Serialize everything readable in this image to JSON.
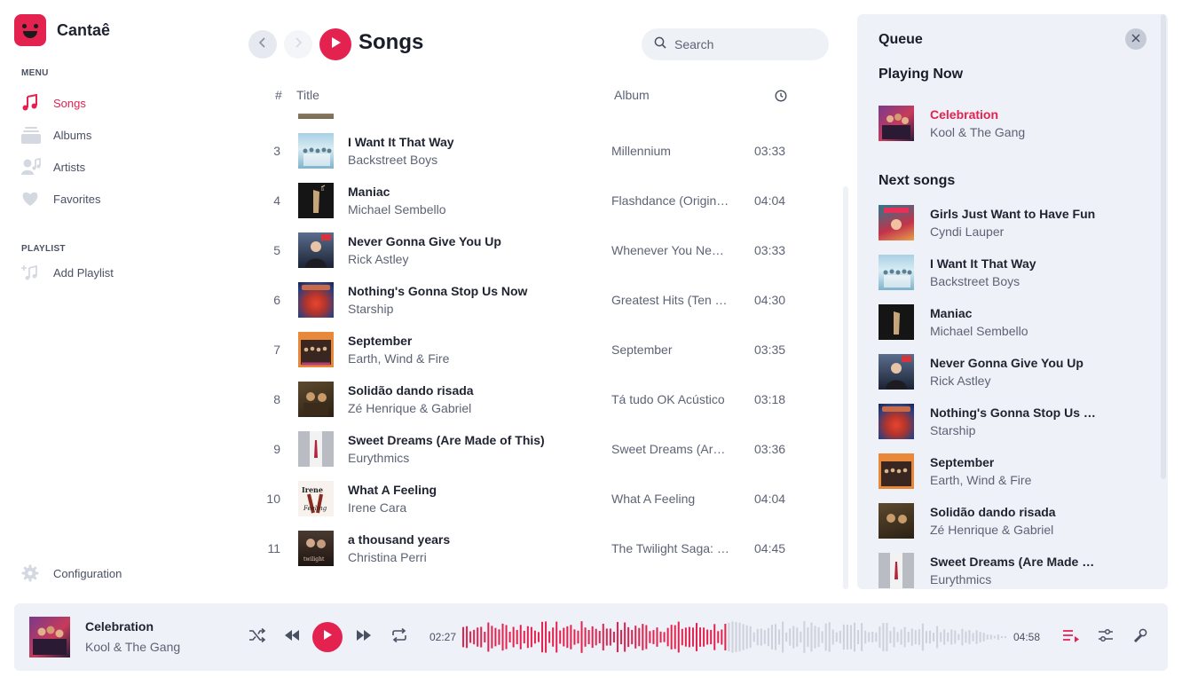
{
  "app": {
    "name": "Cantaê"
  },
  "sidebar": {
    "menu_label": "MENU",
    "items": [
      {
        "label": "Songs",
        "icon": "music-note-icon",
        "active": true
      },
      {
        "label": "Albums",
        "icon": "albums-icon",
        "active": false
      },
      {
        "label": "Artists",
        "icon": "artist-icon",
        "active": false
      },
      {
        "label": "Favorites",
        "icon": "heart-icon",
        "active": false
      }
    ],
    "playlist_label": "PLAYLIST",
    "add_playlist": "Add Playlist",
    "configuration": "Configuration"
  },
  "main": {
    "title": "Songs",
    "search_placeholder": "Search",
    "columns": {
      "number": "#",
      "title": "Title",
      "album": "Album",
      "duration_icon": "clock-icon"
    },
    "songs": [
      {
        "n": "3",
        "title": "I Want It That Way",
        "artist": "Backstreet Boys",
        "album": "Millennium",
        "duration": "03:33"
      },
      {
        "n": "4",
        "title": "Maniac",
        "artist": "Michael Sembello",
        "album": "Flashdance (Original Soundtrack)",
        "duration": "04:04"
      },
      {
        "n": "5",
        "title": "Never Gonna Give You Up",
        "artist": "Rick Astley",
        "album": "Whenever You Need Somebody",
        "duration": "03:33"
      },
      {
        "n": "6",
        "title": "Nothing's Gonna Stop Us Now",
        "artist": "Starship",
        "album": "Greatest Hits (Ten Years and Change)",
        "duration": "04:30"
      },
      {
        "n": "7",
        "title": "September",
        "artist": "Earth, Wind & Fire",
        "album": "September",
        "duration": "03:35"
      },
      {
        "n": "8",
        "title": "Solidão dando risada",
        "artist": "Zé Henrique & Gabriel",
        "album": "Tá tudo OK Acústico",
        "duration": "03:18"
      },
      {
        "n": "9",
        "title": "Sweet Dreams (Are Made of This)",
        "artist": "Eurythmics",
        "album": "Sweet Dreams (Are Made of This)",
        "duration": "03:36"
      },
      {
        "n": "10",
        "title": "What A Feeling",
        "artist": "Irene Cara",
        "album": "What A Feeling",
        "duration": "04:04"
      },
      {
        "n": "11",
        "title": "a thousand years",
        "artist": "Christina Perri",
        "album": "The Twilight Saga: Breaking Dawn",
        "duration": "04:45"
      }
    ]
  },
  "queue": {
    "title": "Queue",
    "playing_now_label": "Playing Now",
    "now": {
      "title": "Celebration",
      "artist": "Kool & The Gang"
    },
    "next_label": "Next songs",
    "next": [
      {
        "title": "Girls Just Want to Have Fun",
        "artist": "Cyndi Lauper"
      },
      {
        "title": "I Want It That Way",
        "artist": "Backstreet Boys"
      },
      {
        "title": "Maniac",
        "artist": "Michael Sembello"
      },
      {
        "title": "Never Gonna Give You Up",
        "artist": "Rick Astley"
      },
      {
        "title": "Nothing's Gonna Stop Us Now",
        "artist": "Starship"
      },
      {
        "title": "September",
        "artist": "Earth, Wind & Fire"
      },
      {
        "title": "Solidão dando risada",
        "artist": "Zé Henrique & Gabriel"
      },
      {
        "title": "Sweet Dreams (Are Made of This)",
        "artist": "Eurythmics"
      }
    ]
  },
  "player": {
    "title": "Celebration",
    "artist": "Kool & The Gang",
    "elapsed": "02:27",
    "total": "04:58",
    "progress": 0.49
  },
  "colors": {
    "accent": "#e3224f",
    "panel": "#eef1f7",
    "muted_text": "#5d6375",
    "wave_inactive": "#cdd1db"
  }
}
